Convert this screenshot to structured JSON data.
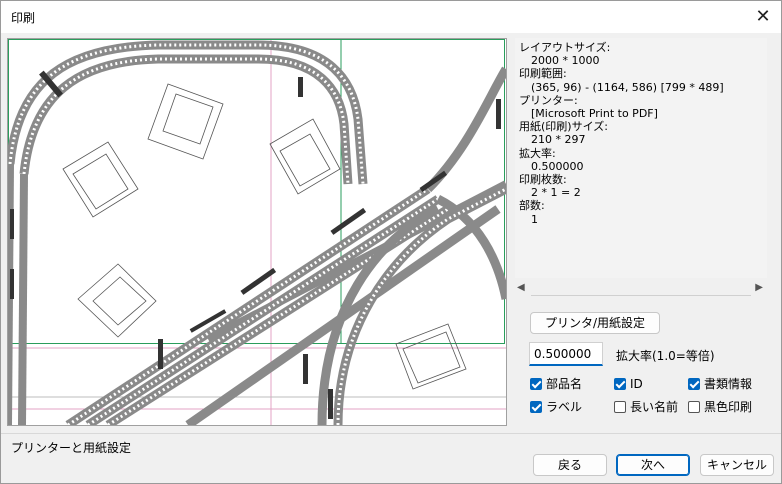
{
  "window": {
    "title": "印刷"
  },
  "info": [
    {
      "label": "レイアウトサイズ:",
      "value": "2000 * 1000"
    },
    {
      "label": "印刷範囲:",
      "value": "(365, 96) - (1164, 586) [799 * 489]"
    },
    {
      "label": "プリンター:",
      "value": "[Microsoft Print to PDF]"
    },
    {
      "label": "用紙(印刷)サイズ:",
      "value": "210 * 297"
    },
    {
      "label": "拡大率:",
      "value": "0.500000"
    },
    {
      "label": "印刷枚数:",
      "value": "2 * 1 = 2"
    },
    {
      "label": "部数:",
      "value": "1"
    }
  ],
  "controls": {
    "printer_setup_label": "プリンタ/用紙設定",
    "scale_value": "0.500000",
    "scale_label": "拡大率(1.0=等倍)"
  },
  "checkboxes": [
    {
      "label": "部品名",
      "checked": true
    },
    {
      "label": "ID",
      "checked": true
    },
    {
      "label": "書類情報",
      "checked": true
    },
    {
      "label": "ラベル",
      "checked": true
    },
    {
      "label": "長い名前",
      "checked": false
    },
    {
      "label": "黒色印刷",
      "checked": false
    }
  ],
  "status": "プリンターと用紙設定",
  "buttons": {
    "back": "戻る",
    "next": "次へ",
    "cancel": "キャンセル"
  },
  "colors": {
    "accent": "#0067c0",
    "page_border": "#2a9d5c",
    "guide": "#e3a3c4",
    "track": "#8a8a8a"
  }
}
